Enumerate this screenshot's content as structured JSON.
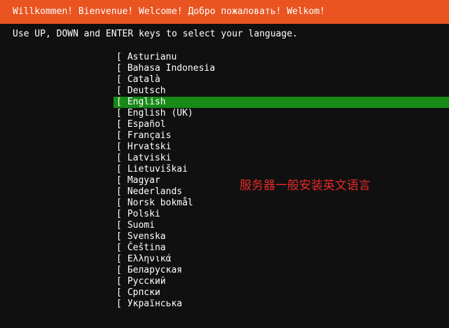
{
  "header": {
    "title": "Willkommen! Bienvenue! Welcome! Добро пожаловать! Welkom!",
    "background": "#e95420"
  },
  "instruction": "Use UP, DOWN and ENTER keys to select your language.",
  "list_marker": "[",
  "selected_color": "#178a17",
  "languages": [
    {
      "label": "Asturianu",
      "selected": false
    },
    {
      "label": "Bahasa Indonesia",
      "selected": false
    },
    {
      "label": "Català",
      "selected": false
    },
    {
      "label": "Deutsch",
      "selected": false
    },
    {
      "label": "English",
      "selected": true
    },
    {
      "label": "English (UK)",
      "selected": false
    },
    {
      "label": "Español",
      "selected": false
    },
    {
      "label": "Français",
      "selected": false
    },
    {
      "label": "Hrvatski",
      "selected": false
    },
    {
      "label": "Latviski",
      "selected": false
    },
    {
      "label": "Lietuviškai",
      "selected": false
    },
    {
      "label": "Magyar",
      "selected": false
    },
    {
      "label": "Nederlands",
      "selected": false
    },
    {
      "label": "Norsk bokmål",
      "selected": false
    },
    {
      "label": "Polski",
      "selected": false
    },
    {
      "label": "Suomi",
      "selected": false
    },
    {
      "label": "Svenska",
      "selected": false
    },
    {
      "label": "Čeština",
      "selected": false
    },
    {
      "label": "Ελληνικά",
      "selected": false
    },
    {
      "label": "Беларуская",
      "selected": false
    },
    {
      "label": "Русский",
      "selected": false
    },
    {
      "label": "Српски",
      "selected": false
    },
    {
      "label": "Українська",
      "selected": false
    }
  ],
  "annotation": {
    "text": "服务器一般安装英文语言",
    "color": "#e62a2a"
  }
}
